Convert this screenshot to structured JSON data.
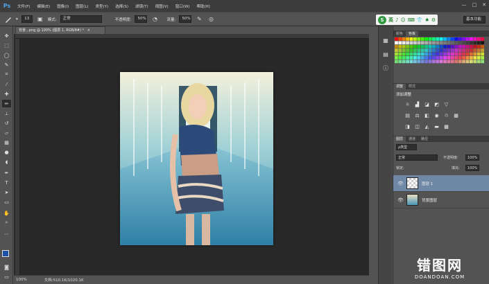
{
  "app": {
    "logo": "Ps"
  },
  "menus": [
    "文件(F)",
    "编辑(E)",
    "图像(I)",
    "图层(L)",
    "类型(Y)",
    "选择(S)",
    "滤镜(T)",
    "视图(V)",
    "窗口(W)",
    "帮助(H)"
  ],
  "window_controls": [
    "—",
    "□",
    "✕"
  ],
  "options": {
    "brush_size": "13",
    "mode_label": "模式:",
    "mode_value": "正常",
    "opacity_label": "不透明度:",
    "opacity_value": "50%",
    "flow_label": "流量:",
    "flow_value": "50%",
    "workspace": "基本功能"
  },
  "brand_icons": [
    "S",
    "英",
    "♪",
    "☺",
    "⌨",
    "👕",
    "♠",
    "⚙"
  ],
  "document": {
    "tab_title": "背景...png @ 100% (图层 1, RGB/8#) *",
    "tab_close": "×",
    "zoom": "100%",
    "doc_info": "文档:510.1K/1020.1K"
  },
  "panels": {
    "color_tabs": [
      "颜色",
      "色板"
    ],
    "adjust_tabs": [
      "调整",
      "样式"
    ],
    "adjust_heading": "添加调整",
    "layer_tabs": [
      "图层",
      "通道",
      "路径"
    ],
    "kind_filter": "ρ类型",
    "blend_mode": "正常",
    "opacity_label": "不透明度:",
    "opacity_value": "100%",
    "lock_label": "锁定:",
    "fill_label": "填充:",
    "fill_value": "100%",
    "layers": [
      {
        "name": "图层 1",
        "selected": true
      },
      {
        "name": "背景图层",
        "selected": false
      }
    ]
  },
  "watermark": {
    "brand": "错图网",
    "url": "DOANDOAN.COM"
  },
  "colors": {
    "accent_blue": "#4fa2e6",
    "selected_layer": "#6f88a6",
    "brand_green": "#2e9a3d"
  },
  "icons": {
    "tools": [
      "move-icon",
      "marquee-icon",
      "lasso-icon",
      "quick-select-icon",
      "crop-icon",
      "eyedropper-icon",
      "healing-icon",
      "brush-icon",
      "clone-stamp-icon",
      "history-brush-icon",
      "eraser-icon",
      "gradient-icon",
      "blur-icon",
      "dodge-icon",
      "pen-icon",
      "type-icon",
      "path-select-icon",
      "shape-icon",
      "hand-icon",
      "zoom-icon"
    ]
  }
}
